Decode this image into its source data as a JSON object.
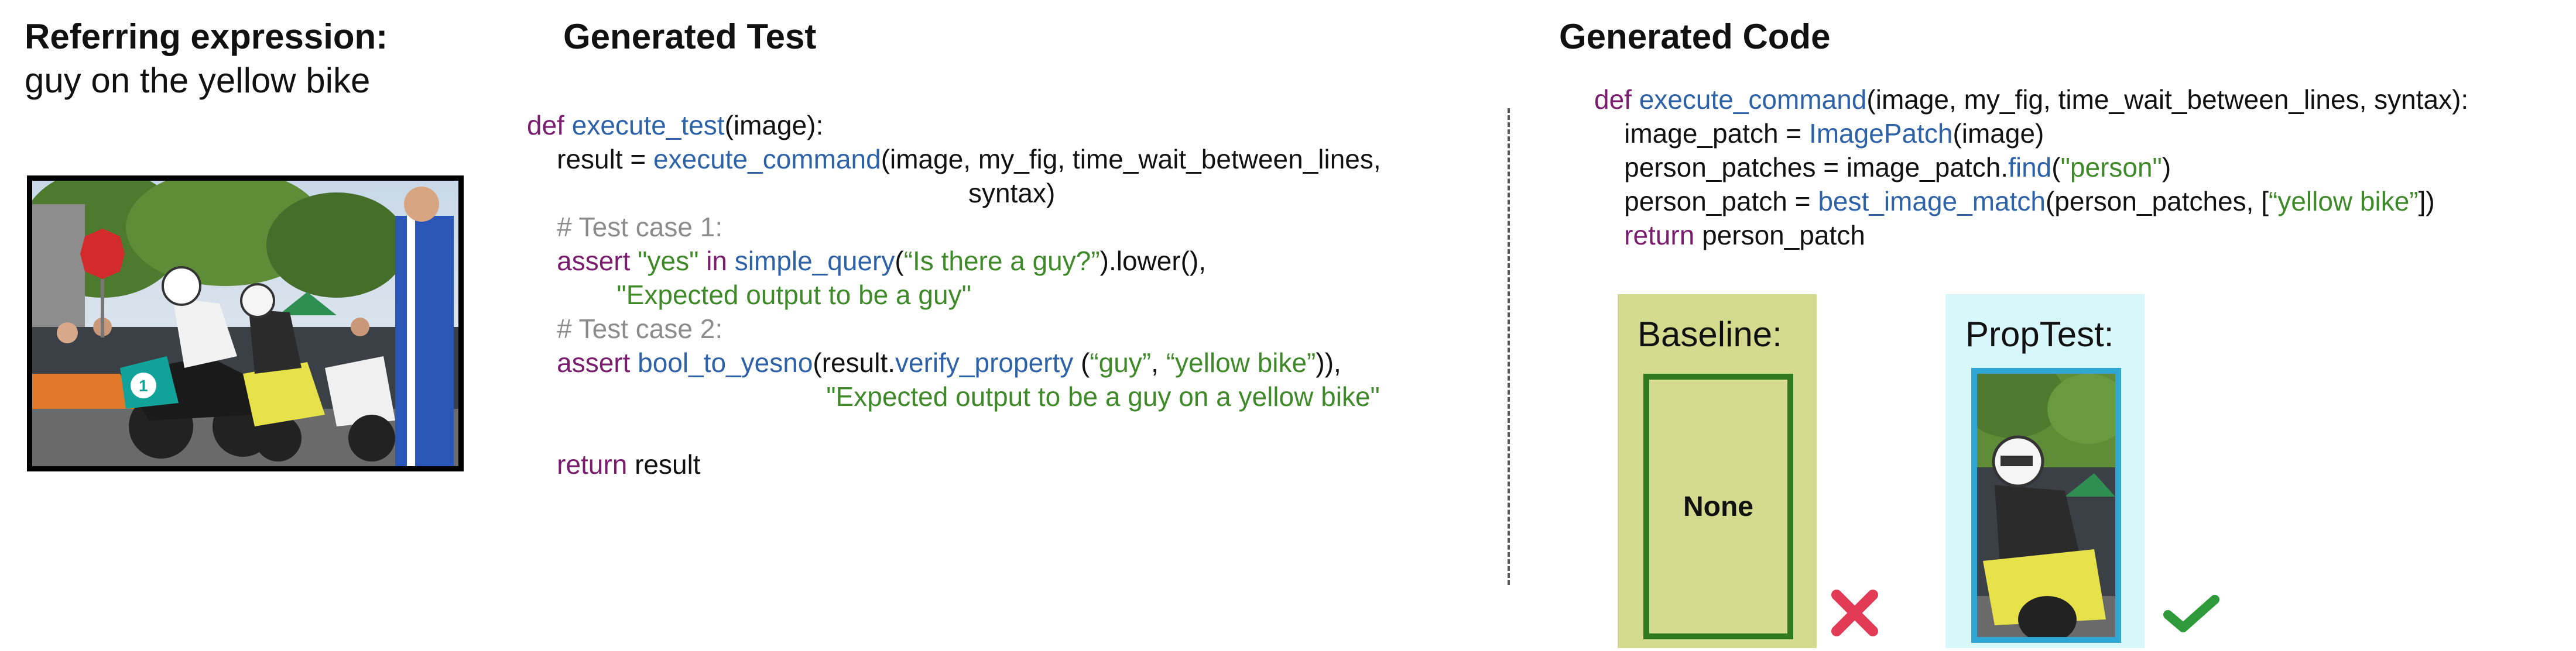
{
  "referring": {
    "heading": "Referring expression:",
    "expression": "guy on the yellow bike"
  },
  "test": {
    "heading": "Generated Test",
    "lines": [
      [
        {
          "t": "def ",
          "c": "kw"
        },
        {
          "t": "execute_test",
          "c": "fn"
        },
        {
          "t": "(image):",
          "c": ""
        }
      ],
      [
        {
          "t": "    result = ",
          "c": ""
        },
        {
          "t": "execute_command",
          "c": "fn"
        },
        {
          "t": "(image, my_fig, time_wait_between_lines,",
          "c": ""
        }
      ],
      [
        {
          "t": "                                                           syntax)",
          "c": ""
        }
      ],
      [
        {
          "t": "    # Test case 1:",
          "c": "cm"
        }
      ],
      [
        {
          "t": "    assert ",
          "c": "kw"
        },
        {
          "t": "\"yes\" ",
          "c": "str"
        },
        {
          "t": "in ",
          "c": "kw"
        },
        {
          "t": "simple_query",
          "c": "fn"
        },
        {
          "t": "(",
          "c": ""
        },
        {
          "t": "“Is there a guy?”",
          "c": "str"
        },
        {
          "t": ").lower(),",
          "c": ""
        }
      ],
      [
        {
          "t": "            ",
          "c": ""
        },
        {
          "t": "\"Expected output to be a guy\"",
          "c": "str"
        }
      ],
      [
        {
          "t": "    # Test case 2:",
          "c": "cm"
        }
      ],
      [
        {
          "t": "    assert ",
          "c": "kw"
        },
        {
          "t": "bool_to_yesno",
          "c": "fn"
        },
        {
          "t": "(result.",
          "c": ""
        },
        {
          "t": "verify_property",
          "c": "fn"
        },
        {
          "t": " (",
          "c": ""
        },
        {
          "t": "“guy”",
          "c": "str"
        },
        {
          "t": ", ",
          "c": ""
        },
        {
          "t": "“yellow bike”",
          "c": "str"
        },
        {
          "t": ")),",
          "c": ""
        }
      ],
      [
        {
          "t": "                                        ",
          "c": ""
        },
        {
          "t": "\"Expected output to be a guy on a yellow bike\"",
          "c": "str"
        }
      ],
      [
        {
          "t": "",
          "c": ""
        }
      ],
      [
        {
          "t": "    return ",
          "c": "kw"
        },
        {
          "t": "result",
          "c": ""
        }
      ]
    ]
  },
  "code": {
    "heading": "Generated Code",
    "lines": [
      [
        {
          "t": "def ",
          "c": "kw"
        },
        {
          "t": "execute_command",
          "c": "fn"
        },
        {
          "t": "(image, my_fig, time_wait_between_lines, syntax):",
          "c": ""
        }
      ],
      [
        {
          "t": "    image_patch = ",
          "c": ""
        },
        {
          "t": "ImagePatch",
          "c": "fn"
        },
        {
          "t": "(image)",
          "c": ""
        }
      ],
      [
        {
          "t": "    person_patches = image_patch.",
          "c": ""
        },
        {
          "t": "find",
          "c": "fn"
        },
        {
          "t": "(",
          "c": ""
        },
        {
          "t": "\"person\"",
          "c": "str"
        },
        {
          "t": ")",
          "c": ""
        }
      ],
      [
        {
          "t": "    person_patch = ",
          "c": ""
        },
        {
          "t": "best_image_match",
          "c": "fn"
        },
        {
          "t": "(person_patches, [",
          "c": ""
        },
        {
          "t": "“yellow bike”",
          "c": "str"
        },
        {
          "t": "])",
          "c": ""
        }
      ],
      [
        {
          "t": "    return ",
          "c": "kw"
        },
        {
          "t": "person_patch",
          "c": ""
        }
      ]
    ]
  },
  "baseline": {
    "label": "Baseline:",
    "result": "None"
  },
  "proptest": {
    "label": "PropTest:"
  },
  "colors": {
    "baseline_bg": "#d4db8f",
    "baseline_border": "#2f7a1e",
    "proptest_bg": "#d8f7fa",
    "proptest_border": "#2fa6d4",
    "cross": "#e23b55",
    "check": "#2e9a3a"
  }
}
